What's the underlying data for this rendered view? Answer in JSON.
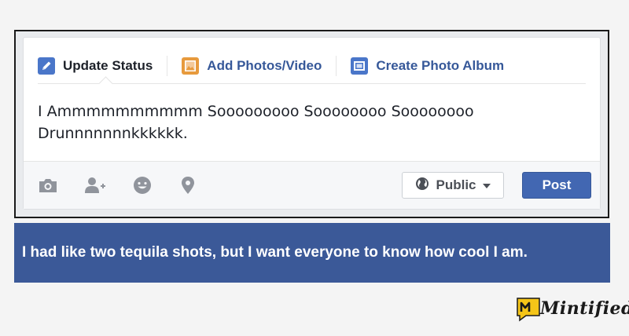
{
  "composer": {
    "tabs": [
      {
        "label": "Update Status",
        "icon": "pencil-icon"
      },
      {
        "label": "Add Photos/Video",
        "icon": "photo-icon"
      },
      {
        "label": "Create Photo Album",
        "icon": "album-icon"
      }
    ],
    "status_text": "I Ammmmmmmmmm Sooooooooo Soooooooo Soooooooo Drunnnnnnnkkkkkk.",
    "footer_icons": [
      "camera-icon",
      "tag-friends-icon",
      "feeling-icon",
      "location-pin-icon"
    ],
    "privacy_label": "Public",
    "post_label": "Post"
  },
  "caption": "I had like two tequila shots, but I want everyone to know how cool I am.",
  "brand": {
    "logo_text": "Mintified"
  },
  "colors": {
    "facebook_blue": "#3b5998",
    "link_blue": "#365899",
    "post_button": "#4267b2",
    "photo_orange": "#e79a3d",
    "logo_yellow": "#f5c518"
  }
}
